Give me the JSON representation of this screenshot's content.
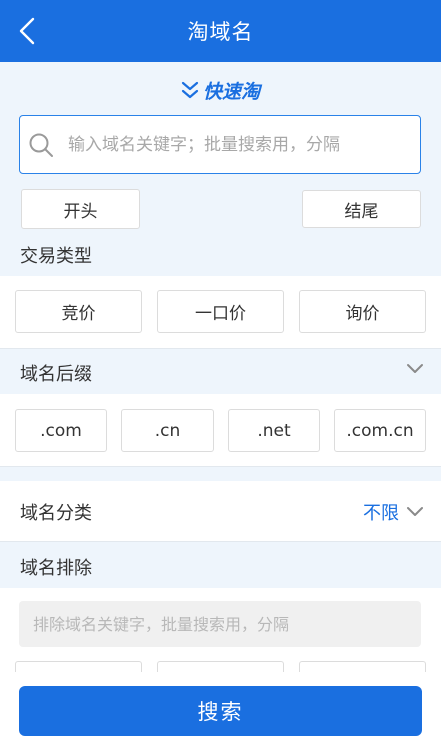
{
  "header": {
    "title": "淘域名"
  },
  "slogan": {
    "text": "快速淘"
  },
  "search": {
    "placeholder": "输入域名关键字；批量搜索用，分隔"
  },
  "position_options": {
    "start": "开头",
    "end": "结尾"
  },
  "trade_type": {
    "label": "交易类型",
    "options": [
      "竞价",
      "一口价",
      "询价"
    ]
  },
  "suffix": {
    "label": "域名后缀",
    "options": [
      ".com",
      ".cn",
      ".net",
      ".com.cn"
    ]
  },
  "category": {
    "label": "域名分类",
    "value": "不限"
  },
  "exclude": {
    "label": "域名排除",
    "placeholder": "排除域名关键字，批量搜索用，分隔"
  },
  "footer": {
    "search_label": "搜索"
  },
  "colors": {
    "accent": "#1a6fe0",
    "background": "#eef5fc"
  }
}
